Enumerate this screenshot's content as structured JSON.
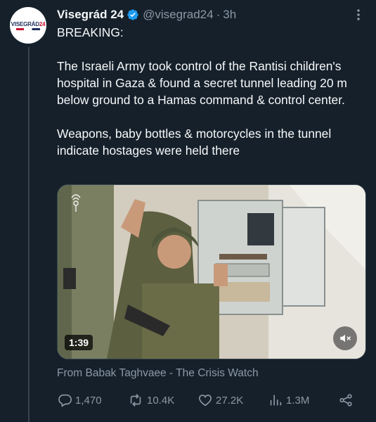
{
  "tweet": {
    "author_name": "Visegrád 24",
    "handle": "@visegrad24",
    "separator": "·",
    "time": "3h",
    "avatar_logo_main": "VISEGRÁD",
    "avatar_logo_num": "24",
    "text_lines": {
      "line1": "BREAKING:",
      "para2": "The Israeli Army took control of the Rantisi children's hospital in Gaza & found a secret tunnel leading 20 m below ground to a Hamas command & control center.",
      "para3": "Weapons, baby bottles & motorcycles in the tunnel indicate hostages were held there"
    },
    "media": {
      "duration": "1:39",
      "icon": "mute-icon"
    },
    "from_label": "From",
    "from_source": "Babak Taghvaee - The Crisis Watch",
    "stats": {
      "replies": "1,470",
      "reposts": "10.4K",
      "likes": "27.2K",
      "views": "1.3M"
    }
  },
  "colors": {
    "background": "#15202b",
    "text": "#f7f9f9",
    "muted": "#8b98a5",
    "verified": "#1d9bf0"
  }
}
